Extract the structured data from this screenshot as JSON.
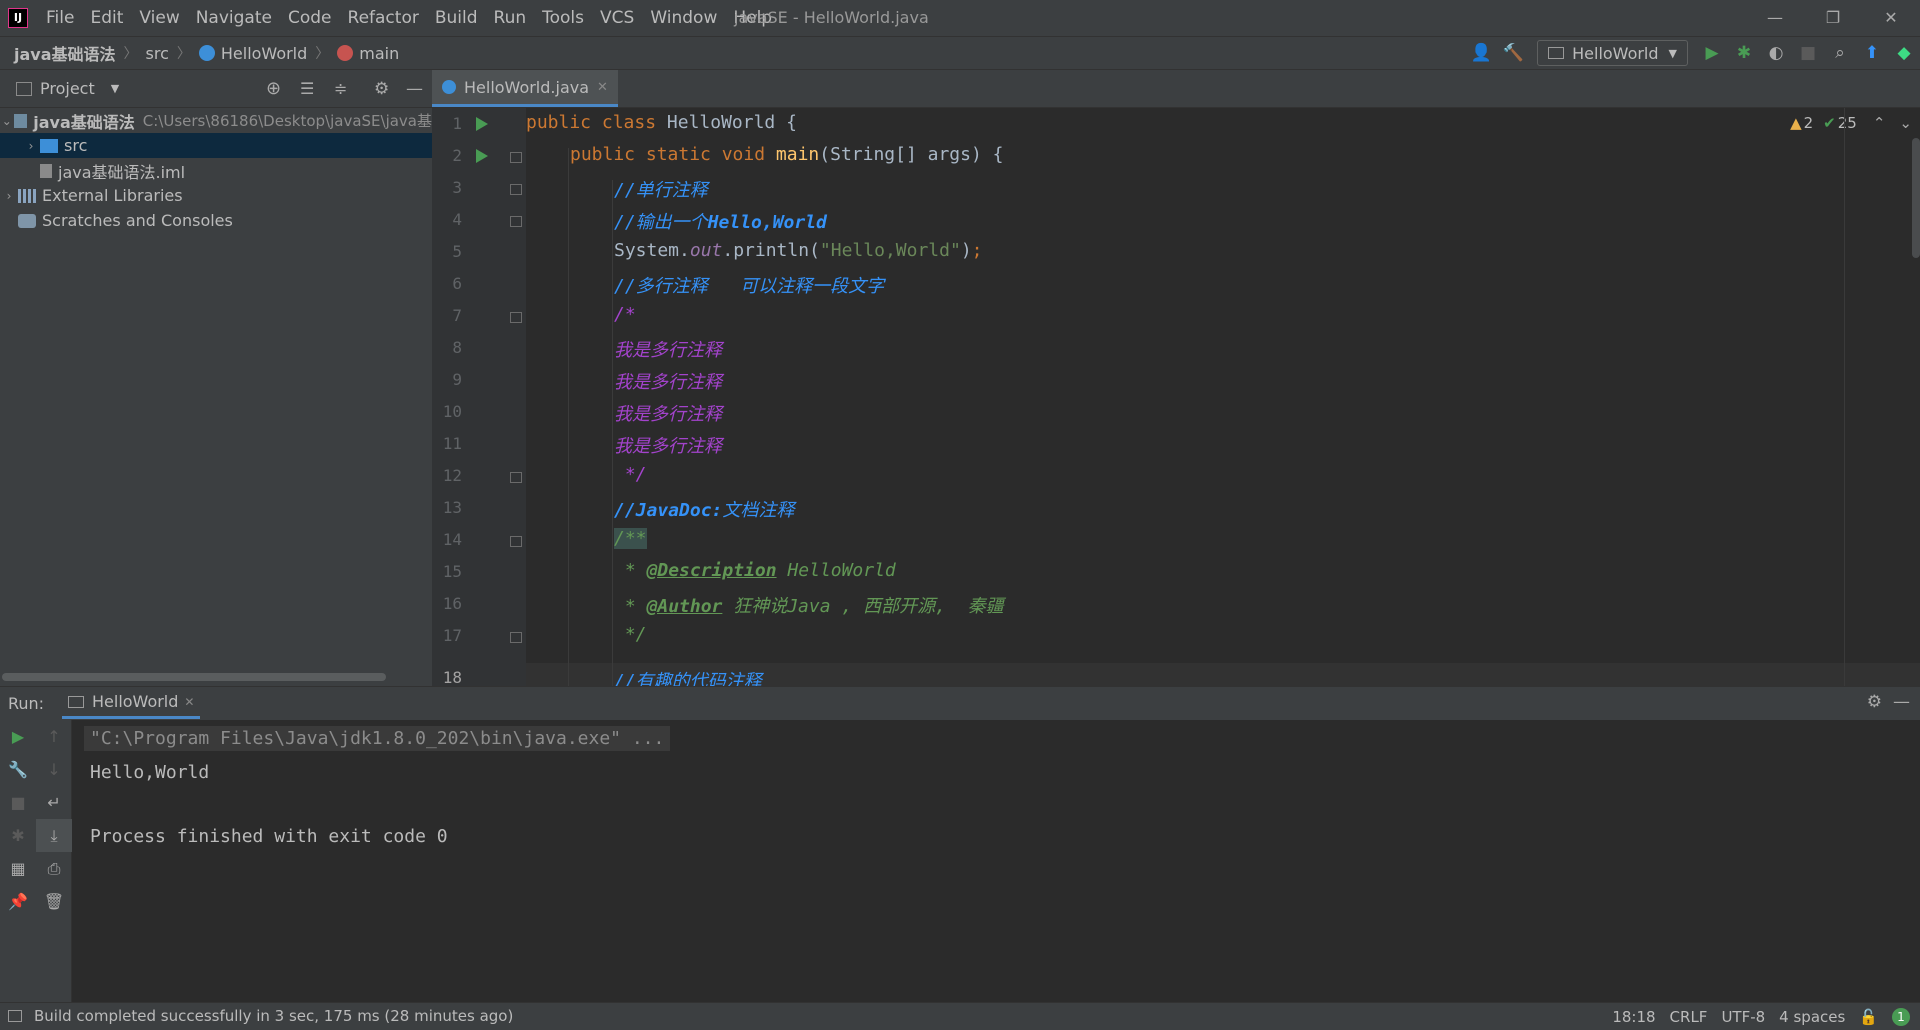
{
  "window": {
    "title": "javaSE - HelloWorld.java",
    "menu": [
      "File",
      "Edit",
      "View",
      "Navigate",
      "Code",
      "Refactor",
      "Build",
      "Run",
      "Tools",
      "VCS",
      "Window",
      "Help"
    ],
    "controls": [
      "—",
      "❐",
      "✕"
    ]
  },
  "breadcrumb": {
    "project": "java基础语法",
    "folder": "src",
    "class": "HelloWorld",
    "method": "main"
  },
  "toolbar": {
    "run_config": "HelloWorld"
  },
  "project_panel": {
    "title": "Project",
    "tree": [
      {
        "label": "java基础语法",
        "path": "C:\\Users\\86186\\Desktop\\javaSE\\java基",
        "expanded": true
      },
      {
        "label": "src",
        "selected": true
      },
      {
        "label": "java基础语法.iml"
      },
      {
        "label": "External Libraries"
      },
      {
        "label": "Scratches and Consoles"
      }
    ]
  },
  "editor": {
    "tab": "HelloWorld.java",
    "warnings": "2",
    "checks": "25",
    "current_line": 18,
    "line_numbers": [
      "1",
      "2",
      "3",
      "4",
      "5",
      "6",
      "7",
      "8",
      "9",
      "10",
      "11",
      "12",
      "13",
      "14",
      "15",
      "16",
      "17",
      "18"
    ],
    "code": {
      "l1_kw": "public class ",
      "l1_name": "HelloWorld {",
      "l2_kw": "public static void ",
      "l2_fn": "main",
      "l2_rest": "(String[] args) {",
      "l3": "//单行注释",
      "l4_a": "//输出一个",
      "l4_b": "Hello,World",
      "l5_a": "System.",
      "l5_field": "out",
      "l5_b": ".println(",
      "l5_str": "\"Hello,World\"",
      "l5_c": ")",
      "l5_semi": ";",
      "l6": "//多行注释   可以注释一段文字",
      "l7": "/*",
      "l8": "我是多行注释",
      "l9": "我是多行注释",
      "l10": "我是多行注释",
      "l11": "我是多行注释",
      "l12": " */",
      "l13_a": "//JavaDoc:",
      "l13_b": "文档注释",
      "l14": "/**",
      "l15_star": " * ",
      "l15_tag": "@Description",
      "l15_rest": " HelloWorld",
      "l16_star": " * ",
      "l16_tag": "@Author",
      "l16_rest": " 狂神说Java , 西部开源,  秦疆",
      "l17": " */",
      "l18": "//有趣的代码注释"
    }
  },
  "run_panel": {
    "label": "Run:",
    "tab": "HelloWorld",
    "console": [
      "\"C:\\Program Files\\Java\\jdk1.8.0_202\\bin\\java.exe\" ...",
      "Hello,World",
      "",
      "Process finished with exit code 0"
    ]
  },
  "statusbar": {
    "message": "Build completed successfully in 3 sec, 175 ms (28 minutes ago)",
    "position": "18:18",
    "line_sep": "CRLF",
    "encoding": "UTF-8",
    "indent": "4 spaces",
    "notifications": "1"
  },
  "colors": {
    "accent": "#4a88c7",
    "run_green": "#499c54",
    "keyword": "#cc7832",
    "line_comment": "#3592f8",
    "block_comment": "#a343cc",
    "doc_comment": "#629755"
  }
}
